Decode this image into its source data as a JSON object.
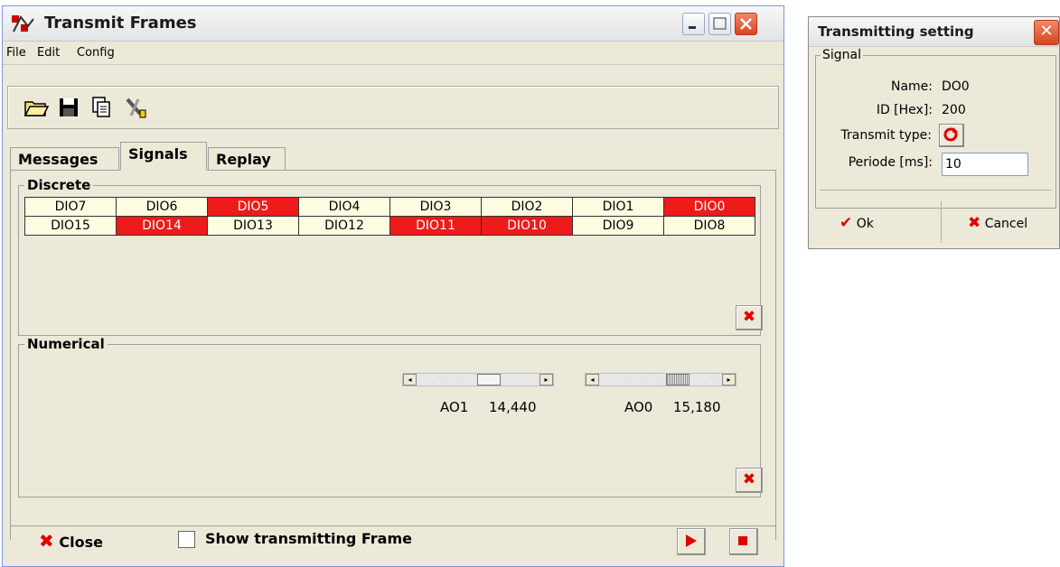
{
  "main_window": {
    "title": "Transmit Frames",
    "menu": [
      {
        "label": "File"
      },
      {
        "label": "Edit"
      },
      {
        "label": "Config"
      }
    ],
    "tabs": [
      {
        "label": "Messages"
      },
      {
        "label": "Signals"
      },
      {
        "label": "Replay"
      }
    ],
    "active_tab": "Signals",
    "discrete": {
      "title": "Discrete",
      "cells": [
        {
          "label": "DIO7",
          "on": false
        },
        {
          "label": "DIO6",
          "on": false
        },
        {
          "label": "DIO5",
          "on": true
        },
        {
          "label": "DIO4",
          "on": false
        },
        {
          "label": "DIO3",
          "on": false
        },
        {
          "label": "DIO2",
          "on": false
        },
        {
          "label": "DIO1",
          "on": false
        },
        {
          "label": "DIO0",
          "on": true
        },
        {
          "label": "DIO15",
          "on": false
        },
        {
          "label": "DIO14",
          "on": true
        },
        {
          "label": "DIO13",
          "on": false
        },
        {
          "label": "DIO12",
          "on": false
        },
        {
          "label": "DIO11",
          "on": true
        },
        {
          "label": "DIO10",
          "on": true
        },
        {
          "label": "DIO9",
          "on": false
        },
        {
          "label": "DIO8",
          "on": false
        }
      ]
    },
    "numerical": {
      "title": "Numerical",
      "sliders": [
        {
          "name": "AO1",
          "value": "14,440",
          "fraction": 0.6
        },
        {
          "name": "AO0",
          "value": "15,180",
          "fraction": 0.66
        }
      ]
    },
    "bottom": {
      "close_label": "Close",
      "show_frame_label": "Show transmitting Frame"
    }
  },
  "dialog": {
    "title": "Transmitting setting",
    "group_title": "Signal",
    "name_label": "Name:",
    "name_value": "DO0",
    "id_label": "ID [Hex]:",
    "id_value": "200",
    "type_label": "Transmit type:",
    "period_label": "Periode [ms]:",
    "period_value": "10",
    "ok_label": "Ok",
    "cancel_label": "Cancel"
  },
  "colors": {
    "on": "#ef1a1a",
    "off": "#fffde1",
    "panel": "#ece9d8"
  }
}
